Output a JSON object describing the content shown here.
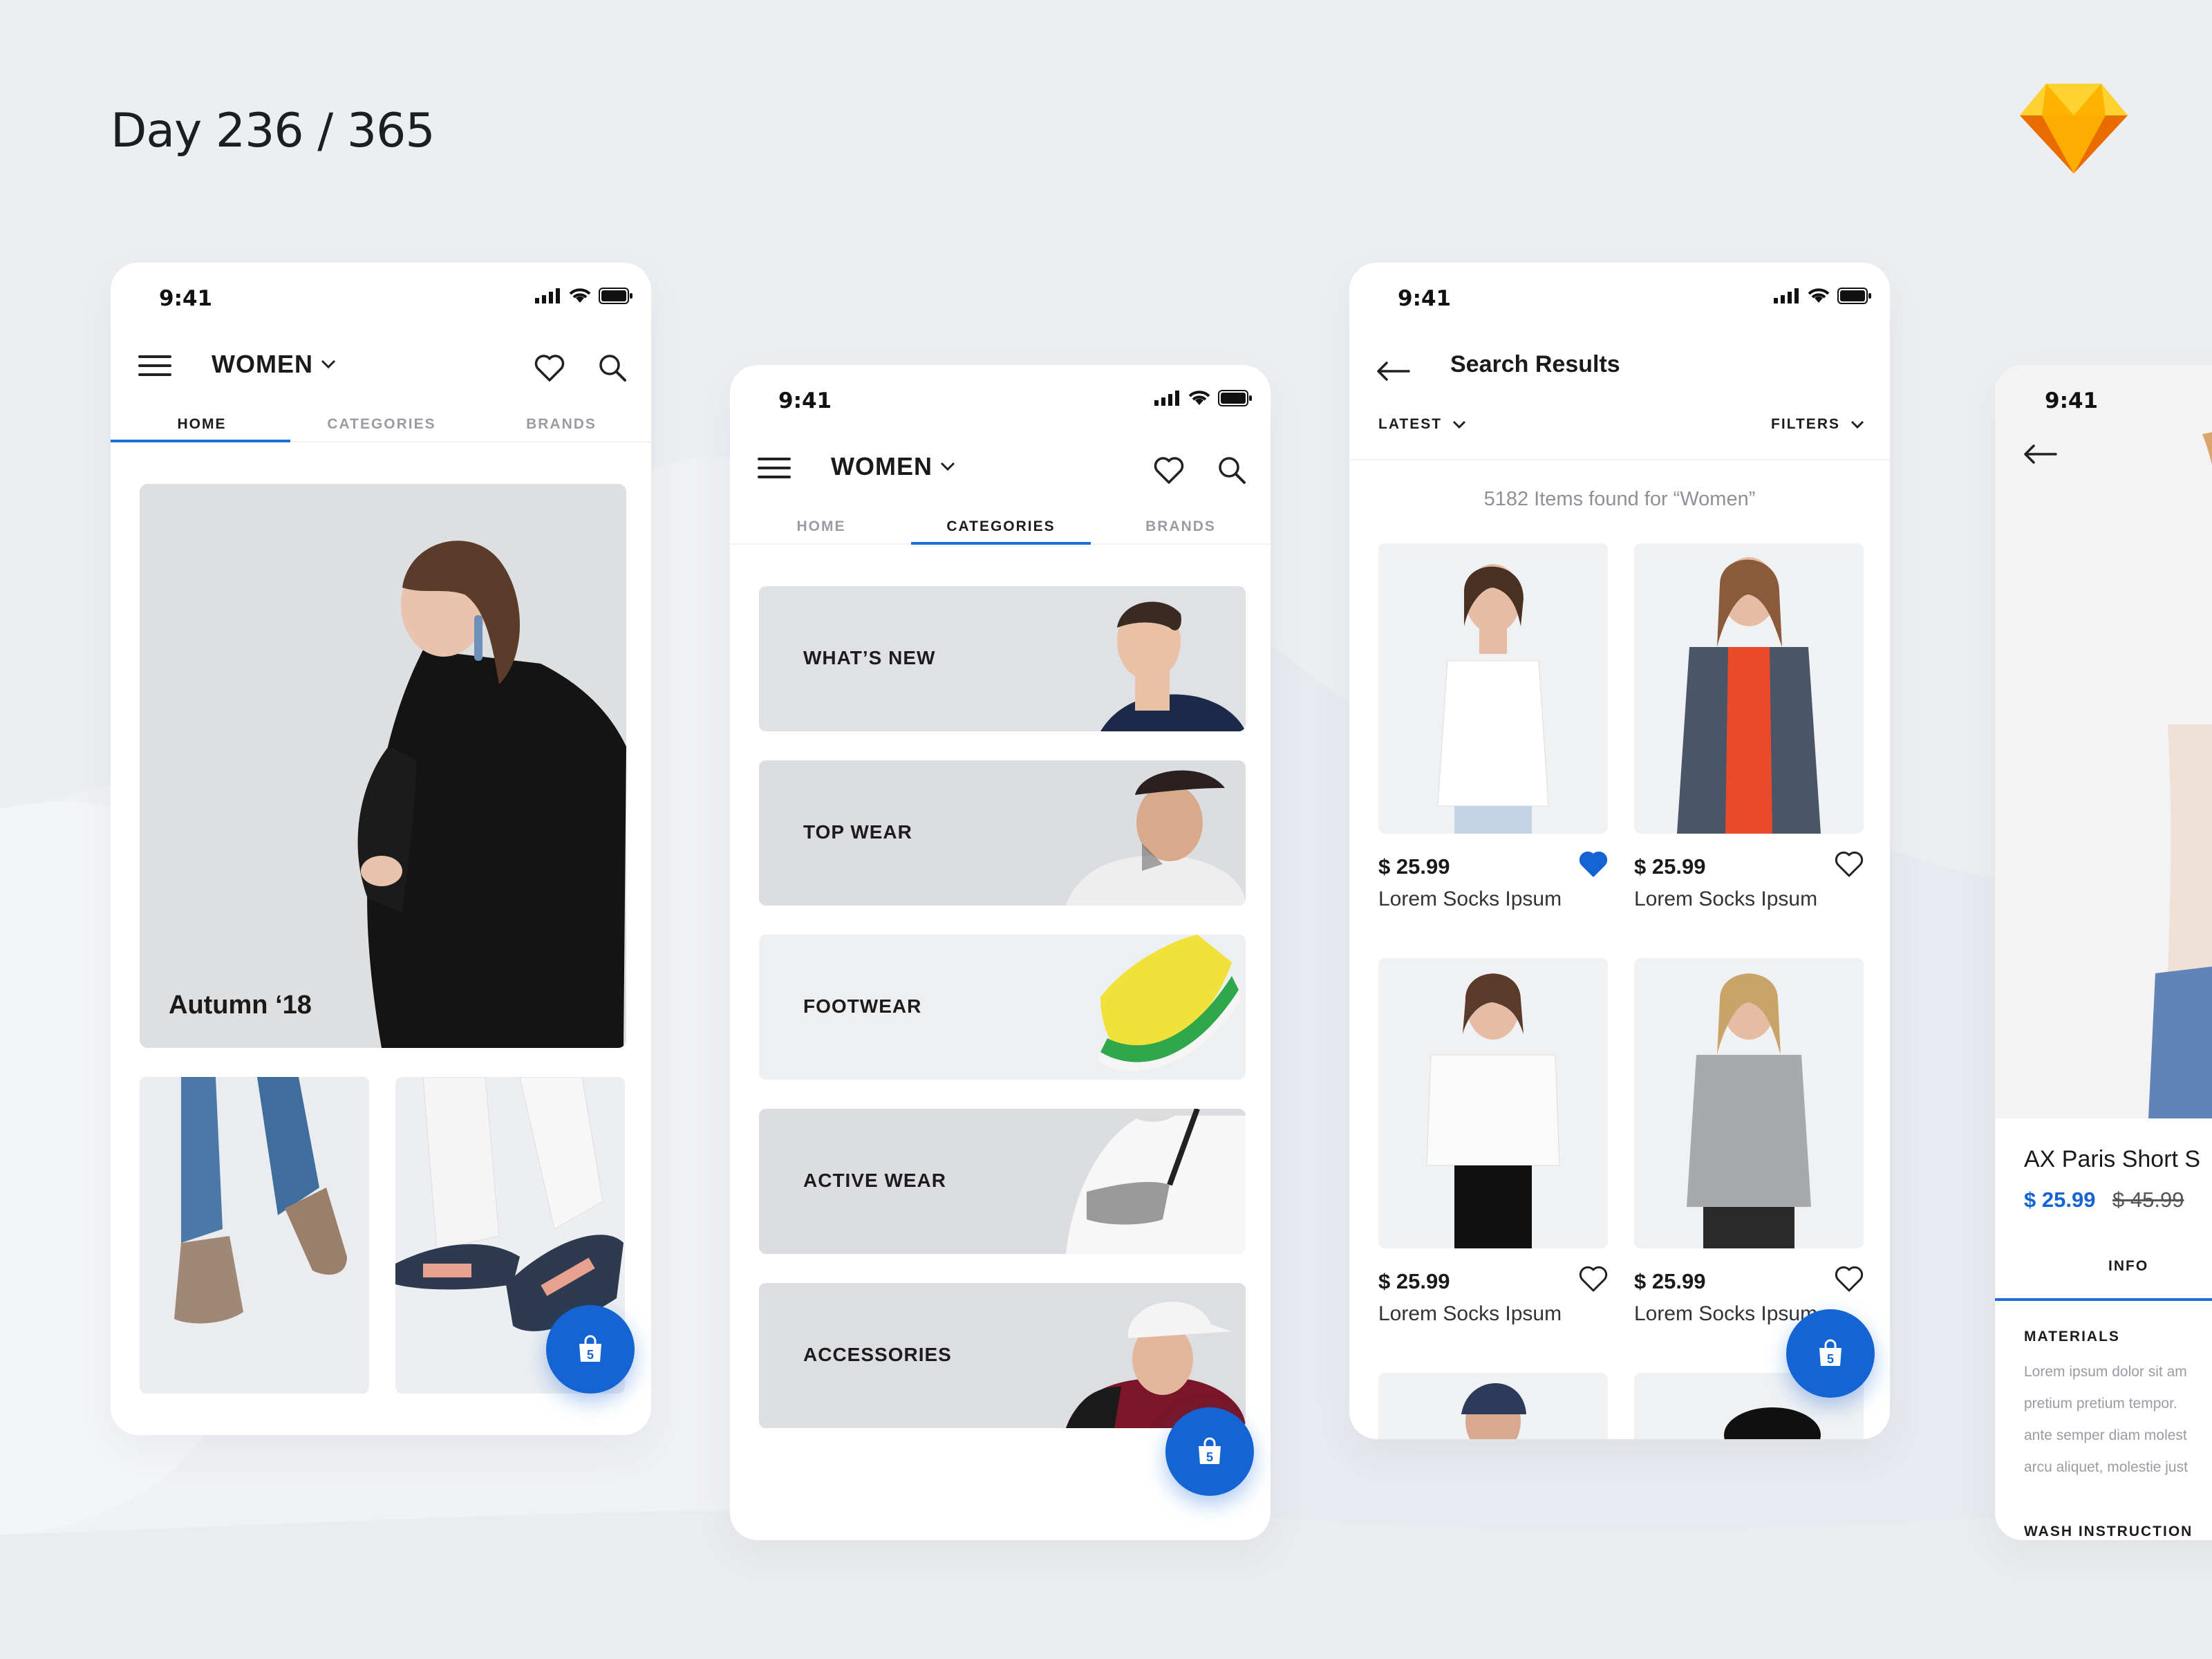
{
  "page": {
    "title": "Day 236 / 365",
    "background": "#eceef2",
    "accent": "#1564d4"
  },
  "sketch_logo": {
    "icon": "sketch-diamond-icon"
  },
  "status_time": "9:41",
  "screen_home": {
    "nav_title": "WOMEN",
    "tabs": [
      "HOME",
      "CATEGORIES",
      "BRANDS"
    ],
    "active_tab": "HOME",
    "hero_label": "Autumn ‘18",
    "cart_count": "5"
  },
  "screen_categories": {
    "nav_title": "WOMEN",
    "tabs": [
      "HOME",
      "CATEGORIES",
      "BRANDS"
    ],
    "active_tab": "CATEGORIES",
    "categories": [
      "WHAT’S NEW",
      "TOP WEAR",
      "FOOTWEAR",
      "ACTIVE WEAR",
      "ACCESSORIES"
    ],
    "cart_count": "5"
  },
  "screen_search": {
    "title": "Search Results",
    "sort_label": "LATEST",
    "filters_label": "FILTERS",
    "found_text": "5182 Items found for “Women”",
    "products": [
      {
        "price": "$ 25.99",
        "name": "Lorem Socks Ipsum",
        "favorite": true
      },
      {
        "price": "$ 25.99",
        "name": "Lorem Socks Ipsum",
        "favorite": false
      },
      {
        "price": "$ 25.99",
        "name": "Lorem Socks Ipsum",
        "favorite": false
      },
      {
        "price": "$ 25.99",
        "name": "Lorem Socks Ipsum",
        "favorite": false
      }
    ],
    "cart_count": "5"
  },
  "screen_detail": {
    "product_name": "AX Paris Short S",
    "price": "$ 25.99",
    "old_price": "$ 45.99",
    "tab": "INFO",
    "materials_heading": "MATERIALS",
    "materials_lines": [
      "Lorem ipsum dolor sit am",
      "pretium pretium tempor.",
      "ante semper diam molest",
      "arcu aliquet, molestie just"
    ],
    "wash_heading": "WASH INSTRUCTION"
  }
}
